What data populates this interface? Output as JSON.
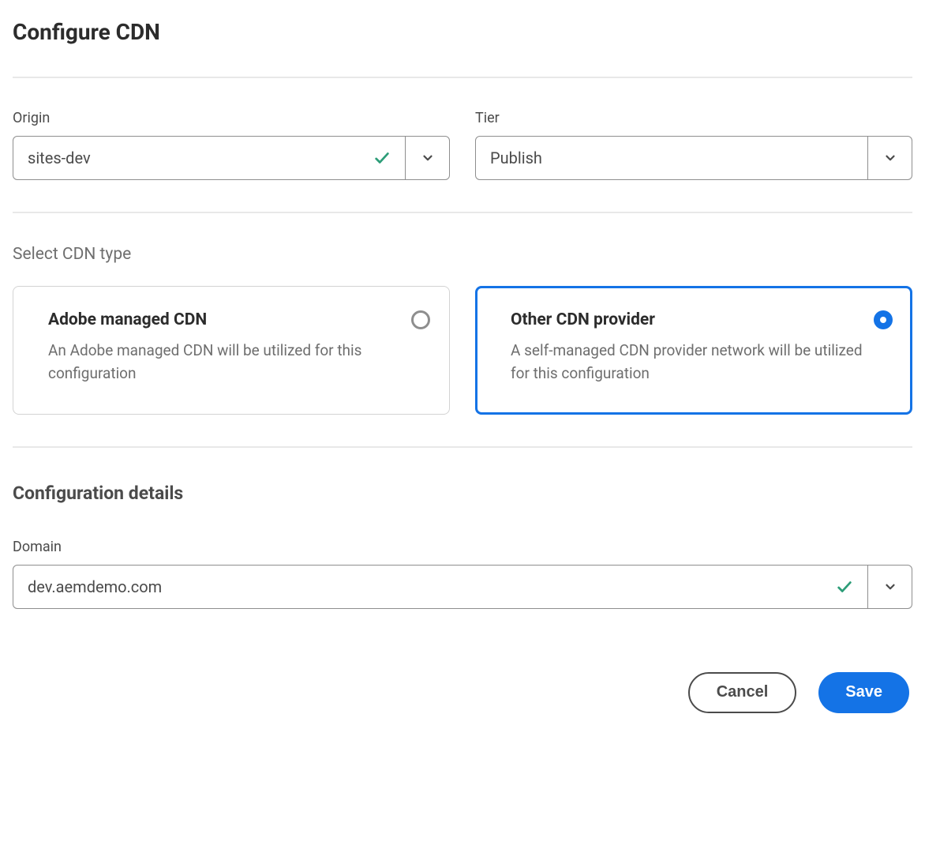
{
  "title": "Configure CDN",
  "fields": {
    "origin": {
      "label": "Origin",
      "value": "sites-dev",
      "validated": true
    },
    "tier": {
      "label": "Tier",
      "value": "Publish",
      "validated": false
    }
  },
  "cdn_type": {
    "section_label": "Select CDN type",
    "options": [
      {
        "title": "Adobe managed CDN",
        "description": "An Adobe managed CDN will be utilized for this configuration",
        "selected": false
      },
      {
        "title": "Other CDN provider",
        "description": "A self-managed CDN provider network will be utilized for this configuration",
        "selected": true
      }
    ]
  },
  "config": {
    "heading": "Configuration details",
    "domain": {
      "label": "Domain",
      "value": "dev.aemdemo.com",
      "validated": true
    }
  },
  "footer": {
    "cancel_label": "Cancel",
    "save_label": "Save"
  },
  "colors": {
    "accent": "#1473e6",
    "success": "#2d9d78"
  }
}
